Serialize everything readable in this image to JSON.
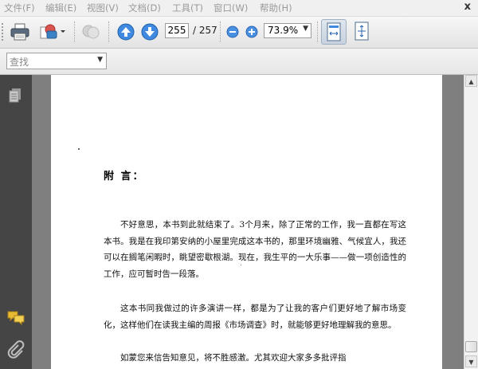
{
  "menu": [
    {
      "label": "文件(F)"
    },
    {
      "label": "编辑(E)"
    },
    {
      "label": "视图(V)"
    },
    {
      "label": "文档(D)"
    },
    {
      "label": "工具(T)"
    },
    {
      "label": "窗口(W)"
    },
    {
      "label": "帮助(H)"
    }
  ],
  "window": {
    "close_label": "x"
  },
  "toolbar": {
    "icons": [
      "print-icon",
      "share-icon",
      "collaborate-icon",
      "previous-page-icon",
      "next-page-icon",
      "zoom-out-icon",
      "zoom-in-icon",
      "fit-width-icon",
      "fit-page-icon"
    ],
    "current_page": "255",
    "total_pages": "/ 257",
    "zoom": "73.9%"
  },
  "find": {
    "placeholder": "查找"
  },
  "nav": {
    "icons": [
      "pages-icon",
      "comments-icon",
      "attachments-icon"
    ]
  },
  "document": {
    "heading": "附 言：",
    "paragraphs": [
      "不好意思，本书到此就结束了。3个月来，除了正常的工作，我一直都在写这本书。我是在我印第安纳的小屋里完成这本书的，那里环境幽雅、气候宜人，我还可以在搁笔闲暇时，眺望密歇根湖。现在，我生平的一大乐事——做一项创造性的工作，应可暂时告一段落。",
      "这本书同我做过的许多演讲一样，都是为了让我的客户们更好地了解市场变化，这样他们在读我主编的周报《市场调查》时，就能够更好地理解我的意思。",
      "如蒙您来信告知意见，将不胜感激。尤其欢迎大家多多批评指"
    ]
  },
  "colors": {
    "accent": "#2f7fd6",
    "nav_bg": "#454545",
    "doc_bg": "#7f7f7f"
  }
}
